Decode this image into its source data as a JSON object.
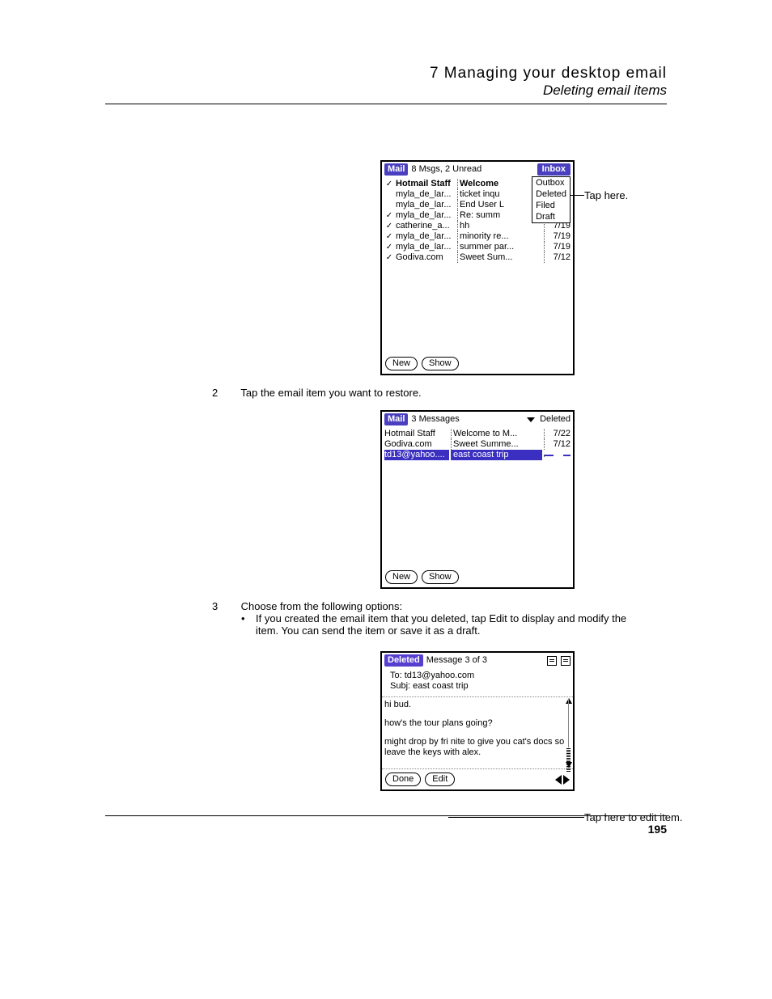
{
  "header": {
    "chapter": "7 Managing your desktop email",
    "section": "Deleting email items"
  },
  "page_number": "195",
  "callouts": {
    "tap_here": "Tap here.",
    "tap_edit": "Tap here to edit item."
  },
  "steps": {
    "s2": "Tap the email item you want to restore.",
    "s3": "Choose from the following options:",
    "s3_bullet": "If you created the email item that you deleted, tap Edit to display and modify the item. You can send the item or save it as a draft."
  },
  "screen1": {
    "title": "Mail",
    "count": "8 Msgs, 2 Unread",
    "folder_selected": "Inbox",
    "dropdown": [
      "Outbox",
      "Deleted",
      "Filed",
      "Draft"
    ],
    "rows": [
      {
        "check": "✓",
        "sender": "Hotmail Staff",
        "subject": "Welcome",
        "date": ""
      },
      {
        "check": "",
        "sender": "myla_de_lar...",
        "subject": "ticket inqu",
        "date": ""
      },
      {
        "check": "",
        "sender": "myla_de_lar...",
        "subject": "End User L",
        "date": ""
      },
      {
        "check": "✓",
        "sender": "myla_de_lar...",
        "subject": "Re: summ",
        "date": ""
      },
      {
        "check": "✓",
        "sender": "catherine_a...",
        "subject": "hh",
        "date": "7/19"
      },
      {
        "check": "✓",
        "sender": "myla_de_lar...",
        "subject": "minority re...",
        "date": "7/19"
      },
      {
        "check": "✓",
        "sender": "myla_de_lar...",
        "subject": "summer par...",
        "date": "7/19"
      },
      {
        "check": "✓",
        "sender": "Godiva.com",
        "subject": "Sweet Sum...",
        "date": "7/12"
      }
    ],
    "buttons": {
      "new": "New",
      "show": "Show"
    }
  },
  "screen2": {
    "title": "Mail",
    "count": "3 Messages",
    "folder": "Deleted",
    "rows": [
      {
        "sender": "Hotmail Staff",
        "subject": "Welcome to M...",
        "date": "7/22",
        "selected": false
      },
      {
        "sender": "Godiva.com",
        "subject": "Sweet Summe...",
        "date": "7/12",
        "selected": false
      },
      {
        "sender": "td13@yahoo....",
        "subject": "east coast trip",
        "date": "",
        "selected": true
      }
    ],
    "buttons": {
      "new": "New",
      "show": "Show"
    }
  },
  "screen3": {
    "title": "Deleted",
    "count": "Message 3 of 3",
    "to_label": "To:",
    "to": "td13@yahoo.com",
    "subj_label": "Subj:",
    "subj": "east coast trip",
    "body": [
      "hi bud.",
      "how's the tour plans going?",
      "might drop by fri nite to give you cat's docs so leave the keys with alex."
    ],
    "buttons": {
      "done": "Done",
      "edit": "Edit"
    }
  }
}
